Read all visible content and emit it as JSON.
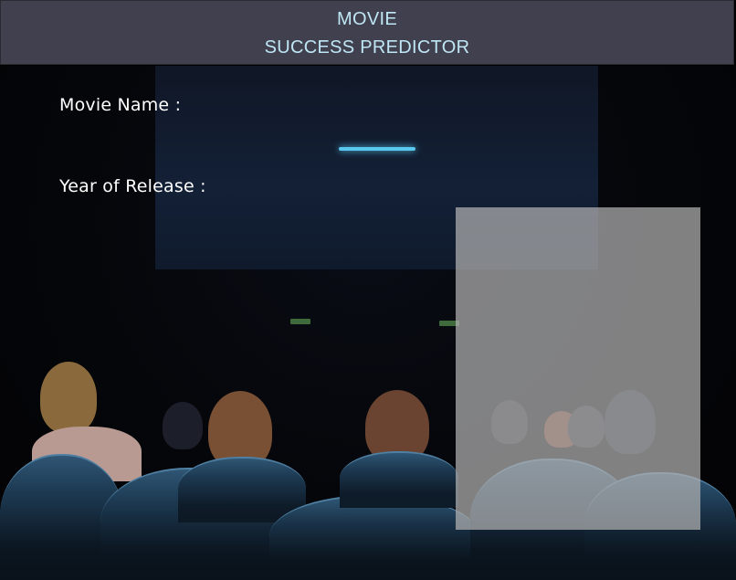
{
  "header": {
    "title_line1": "MOVIE",
    "title_line2": "SUCCESS PREDICTOR"
  },
  "form": {
    "movie_name_label": "Movie Name :",
    "year_of_release_label": "Year of Release :"
  },
  "colors": {
    "header_background": "#41404e",
    "header_text": "#bfe6f5",
    "label_text": "#ffffff",
    "panel_overlay": "#b2b2b2"
  }
}
